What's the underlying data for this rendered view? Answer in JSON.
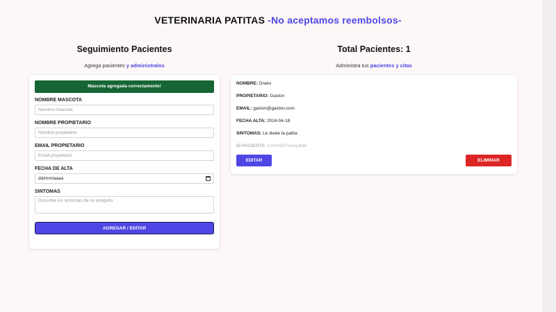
{
  "header": {
    "title": "VETERINARIA PATITAS",
    "tagline": "-No aceptamos reembolsos-"
  },
  "form_section": {
    "heading": "Seguimiento Pacientes",
    "subtitle_prefix": "Agrega pacientes",
    "subtitle_connector": "y",
    "subtitle_link": "administralos",
    "alert": "Mascota agregada correctamente!",
    "fields": {
      "pet_name": {
        "label": "NOMBRE MASCOTA",
        "placeholder": "Nombre mascota"
      },
      "owner_name": {
        "label": "NOMBRE PROPIETARIO",
        "placeholder": "Nombre propietario"
      },
      "owner_email": {
        "label": "EMAIL PROPIETARIO",
        "placeholder": "Email propietario"
      },
      "discharge_date": {
        "label": "FECHA DE ALTA",
        "placeholder": "dd/mm/aaaa"
      },
      "symptoms": {
        "label": "SINTOMAS",
        "placeholder": "Describe los sintomas de su amiguito"
      }
    },
    "submit_label": "AGREGAR / EDITAR"
  },
  "list_section": {
    "heading_prefix": "Total Pacientes:",
    "total": "1",
    "subtitle_prefix": "Administra tus",
    "subtitle_link": "pacientes y citas"
  },
  "patients": [
    {
      "name_label": "NOMBRE:",
      "name": "Drako",
      "owner_label": "PROPIETARIO:",
      "owner": "Gaston",
      "email_label": "EMAIL:",
      "email": "gaston@gaston.com",
      "date_label": "FECHA ALTA:",
      "date": "2024-04-18",
      "symptoms_label": "SINTOMAS:",
      "symptoms": "Le duele la patita",
      "id_label": "ID PACIENTE:",
      "id": "lv1nrm2t7vluoy3bbr",
      "edit_label": "EDITAR",
      "delete_label": "ELIMINAR"
    }
  ],
  "colors": {
    "background": "#fdf7f7",
    "accent": "#4f46e5",
    "success": "#166534",
    "danger": "#dc2626"
  }
}
